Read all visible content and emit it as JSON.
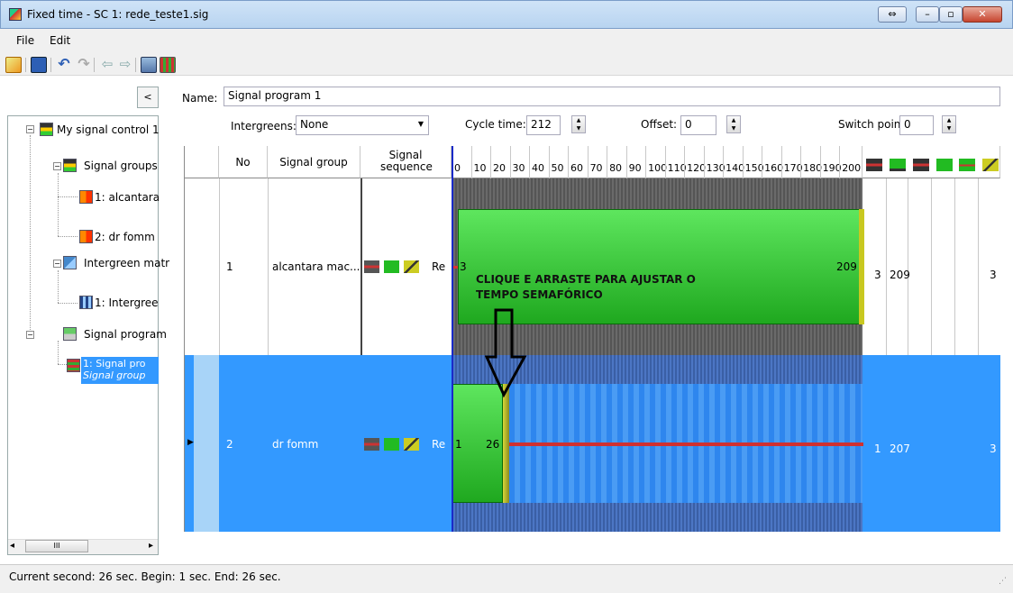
{
  "window": {
    "title": "Fixed time - SC 1: rede_teste1.sig"
  },
  "menu": {
    "file": "File",
    "edit": "Edit"
  },
  "tree": {
    "collapse_label": "<",
    "root": "My signal control 1",
    "signal_groups": "Signal groups",
    "sg1": "1: alcantara",
    "sg2": "2: dr fomm",
    "intergreen_matrices": "Intergreen matr",
    "ig1": "1: Intergree",
    "signal_programs": "Signal program",
    "sp1_line1": "1: Signal pro",
    "sp1_line2": "Signal group",
    "scroll_mark": "III"
  },
  "form": {
    "name_label": "Name:",
    "name_value": "Signal program 1",
    "intergreens_label": "Intergreens:",
    "intergreens_value": "None",
    "cycle_label": "Cycle time:",
    "cycle_value": "212",
    "offset_label": "Offset:",
    "offset_value": "0",
    "switch_label": "Switch point:",
    "switch_value": "0"
  },
  "grid": {
    "headers": {
      "no": "No",
      "signal_group": "Signal group",
      "sequence": "Signal sequence"
    },
    "ticks": [
      "0",
      "10",
      "20",
      "30",
      "40",
      "50",
      "60",
      "70",
      "80",
      "90",
      "100",
      "110",
      "120",
      "130",
      "140",
      "150",
      "160",
      "170",
      "180",
      "190",
      "200"
    ],
    "rows": [
      {
        "no": "1",
        "signal_group": "alcantara mac...",
        "seq_text": "Re",
        "green_start": "3",
        "green_end": "209",
        "c1": "3",
        "c2": "209",
        "c3": "3"
      },
      {
        "no": "2",
        "signal_group": "dr fomm",
        "seq_text": "Re",
        "green_start": "1",
        "green_end": "26",
        "c1": "1",
        "c2": "207",
        "c3": "3"
      }
    ]
  },
  "annotation": {
    "line1": "CLIQUE E ARRASTE PARA AJUSTAR O",
    "line2": "TEMPO SEMAFÓRICO"
  },
  "status": {
    "text": "Current second: 26 sec. Begin: 1 sec. End: 26 sec."
  },
  "colors": {
    "selection": "#3399ff",
    "green": "#2ecc2e",
    "red": "#d03030",
    "amber": "#c8c820"
  }
}
